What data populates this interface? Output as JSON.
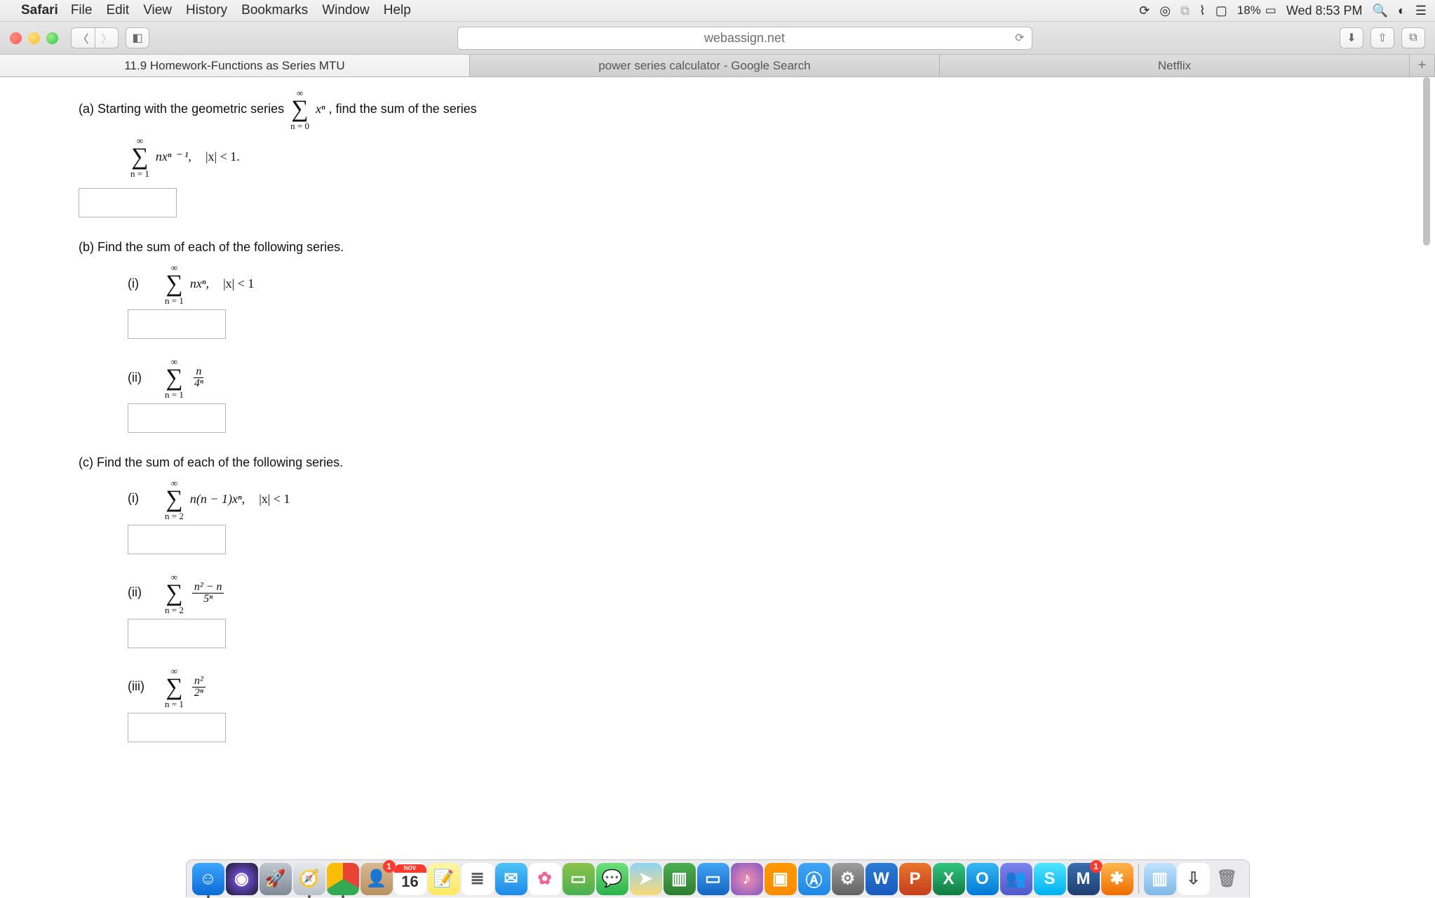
{
  "menubar": {
    "app": "Safari",
    "items": [
      "File",
      "Edit",
      "View",
      "History",
      "Bookmarks",
      "Window",
      "Help"
    ],
    "battery": "18%",
    "datetime": "Wed 8:53 PM"
  },
  "browser": {
    "url": "webassign.net",
    "tabs": [
      {
        "label": "11.9 Homework-Functions as Series MTU",
        "active": true
      },
      {
        "label": "power series calculator - Google Search",
        "active": false
      },
      {
        "label": "Netflix",
        "active": false
      }
    ]
  },
  "problem": {
    "a": {
      "prefix": "(a) Starting with the geometric series ",
      "sumTop": "∞",
      "sumBot": "n = 0",
      "sumBody": "xⁿ",
      "suffix": ", find the sum of the series",
      "seriesTop": "∞",
      "seriesBot": "n = 1",
      "seriesBody": "nxⁿ ⁻ ¹,",
      "cond": "|x| < 1."
    },
    "b": {
      "text": "(b) Find the sum of each of the following series.",
      "i": {
        "label": "(i)",
        "top": "∞",
        "bot": "n = 1",
        "body": "nxⁿ,",
        "cond": "|x| < 1"
      },
      "ii": {
        "label": "(ii)",
        "top": "∞",
        "bot": "n = 1",
        "num": "n",
        "den": "4ⁿ"
      }
    },
    "c": {
      "text": "(c) Find the sum of each of the following series.",
      "i": {
        "label": "(i)",
        "top": "∞",
        "bot": "n = 2",
        "body": "n(n − 1)xⁿ,",
        "cond": "|x| < 1"
      },
      "ii": {
        "label": "(ii)",
        "top": "∞",
        "bot": "n = 2",
        "num": "n² − n",
        "den": "5ⁿ"
      },
      "iii": {
        "label": "(iii)",
        "top": "∞",
        "bot": "n = 1",
        "num": "n²",
        "den": "2ⁿ"
      }
    }
  },
  "dock": {
    "icons": [
      {
        "name": "finder",
        "bg": "linear-gradient(#3ea6ff,#0a6bd6)",
        "glyph": "☺",
        "ind": true
      },
      {
        "name": "siri",
        "bg": "radial-gradient(circle,#8a5cff,#1a1a2e)",
        "glyph": "◉"
      },
      {
        "name": "launchpad",
        "bg": "linear-gradient(#bfc7cf,#7e8a96)",
        "glyph": "🚀"
      },
      {
        "name": "safari",
        "bg": "linear-gradient(#e6e9ec,#bac1c8)",
        "glyph": "🧭",
        "ind": true
      },
      {
        "name": "chrome",
        "bg": "conic-gradient(#ea4335 0 33%,#34a853 33% 66%,#fbbc05 66% 100%)",
        "glyph": "",
        "ind": true
      },
      {
        "name": "contacts",
        "bg": "linear-gradient(#d7b893,#b9915f)",
        "glyph": "👤",
        "badge": "1"
      },
      {
        "name": "calendar",
        "bg": "#fff",
        "glyph": "16",
        "textColor": "#333",
        "calTop": "NOV"
      },
      {
        "name": "notes",
        "bg": "linear-gradient(#fff6a6,#ffe863)",
        "glyph": "📝"
      },
      {
        "name": "reminders",
        "bg": "#fff",
        "glyph": "≣",
        "textColor": "#555"
      },
      {
        "name": "mail",
        "bg": "linear-gradient(#4fc3f7,#1e88e5)",
        "glyph": "✉"
      },
      {
        "name": "photos",
        "bg": "#fff",
        "glyph": "✿",
        "textColor": "#f06292"
      },
      {
        "name": "facetime",
        "bg": "linear-gradient(#8bc34a,#4caf50)",
        "glyph": "▭"
      },
      {
        "name": "messages",
        "bg": "linear-gradient(#6fe07b,#2bb24c)",
        "glyph": "💬"
      },
      {
        "name": "maps",
        "bg": "linear-gradient(#8fd3f4,#f9d976)",
        "glyph": "➤"
      },
      {
        "name": "numbers",
        "bg": "linear-gradient(#4caf50,#2e7d32)",
        "glyph": "▥"
      },
      {
        "name": "keynote",
        "bg": "linear-gradient(#42a5f5,#1565c0)",
        "glyph": "▭"
      },
      {
        "name": "itunes",
        "bg": "radial-gradient(circle,#f48fb1,#7e57c2)",
        "glyph": "♪"
      },
      {
        "name": "ibooks",
        "bg": "linear-gradient(#ff9800,#fb8c00)",
        "glyph": "▣"
      },
      {
        "name": "appstore",
        "bg": "linear-gradient(#42a5f5,#1e88e5)",
        "glyph": "Ⓐ"
      },
      {
        "name": "systemprefs",
        "bg": "linear-gradient(#9e9e9e,#616161)",
        "glyph": "⚙"
      },
      {
        "name": "word",
        "bg": "linear-gradient(#2b7cd3,#185abd)",
        "glyph": "W"
      },
      {
        "name": "powerpoint",
        "bg": "linear-gradient(#e8762d,#c43e1c)",
        "glyph": "P"
      },
      {
        "name": "excel",
        "bg": "linear-gradient(#33c481,#107c41)",
        "glyph": "X"
      },
      {
        "name": "outlook",
        "bg": "linear-gradient(#35b8f1,#0078d4)",
        "glyph": "O"
      },
      {
        "name": "teams",
        "bg": "linear-gradient(#7b83eb,#5059c9)",
        "glyph": "👥"
      },
      {
        "name": "skype",
        "bg": "linear-gradient(#50e6ff,#00aff0)",
        "glyph": "S"
      },
      {
        "name": "malwarebytes",
        "bg": "linear-gradient(#3a6fb0,#1f3e6e)",
        "glyph": "M",
        "badge": "1"
      },
      {
        "name": "spark",
        "bg": "linear-gradient(#ffb74d,#ef6c00)",
        "glyph": "✱"
      }
    ],
    "right": [
      {
        "name": "folder",
        "bg": "linear-gradient(#bfe4ff,#7fb8e6)",
        "glyph": "▥"
      },
      {
        "name": "downloads",
        "bg": "#fff",
        "glyph": "⇩",
        "textColor": "#555"
      },
      {
        "name": "trash",
        "bg": "transparent",
        "glyph": "🗑",
        "textColor": "#888"
      }
    ]
  }
}
